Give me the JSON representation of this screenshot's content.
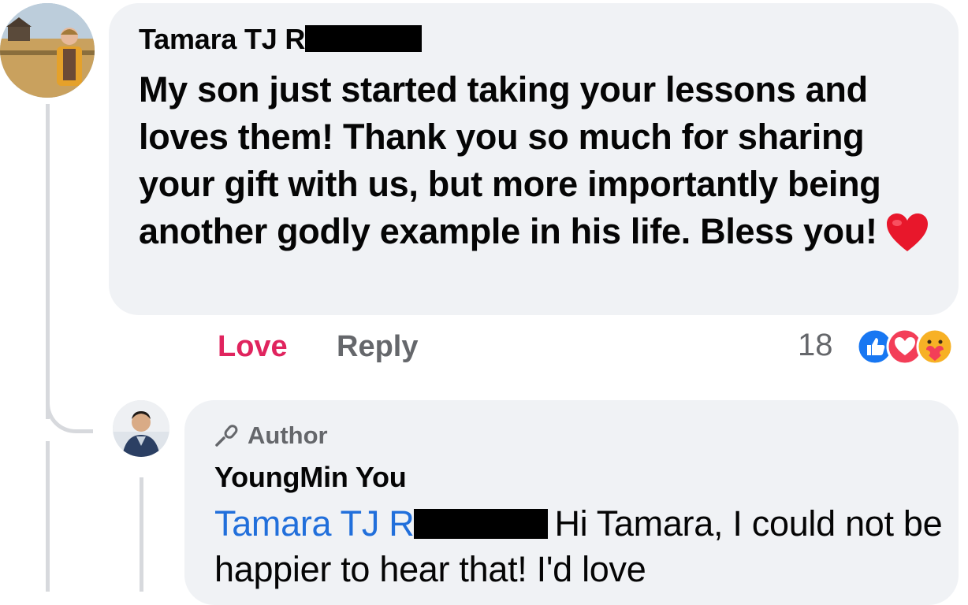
{
  "comment": {
    "author": "Tamara TJ R",
    "text": "My son just started taking your lessons and loves them! Thank you so much for sharing your gift with us, but more importantly being another godly example in his life. Bless you!",
    "actions": {
      "love_label": "Love",
      "reply_label": "Reply"
    },
    "reactions": {
      "count": "18",
      "icons": [
        "like-icon",
        "love-icon",
        "care-icon"
      ]
    }
  },
  "reply": {
    "badge": "Author",
    "author": "YoungMin You",
    "mention": "Tamara TJ R",
    "text": "Hi Tamara, I could not be happier to hear that! I'd love"
  },
  "colors": {
    "bubble": "#f0f2f5",
    "love": "#e0245e",
    "muted": "#65676b",
    "mention": "#216fdb",
    "like_blue": "#1877f2",
    "heart_red": "#f33e58"
  }
}
